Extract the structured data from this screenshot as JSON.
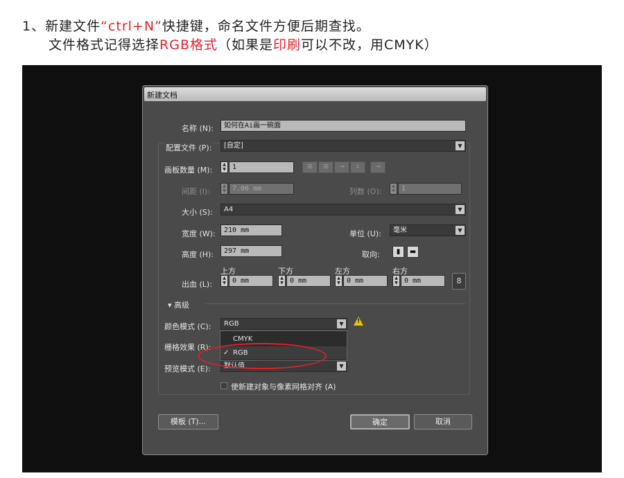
{
  "caption": {
    "line1_prefix": "1、新建文件",
    "line1_highlight": "“ctrl+N”",
    "line1_suffix": "快捷键，命名文件方便后期查找。",
    "line2_prefix": "文件格式记得选择",
    "line2_highlight1": "RGB格式",
    "line2_mid": "（如果是",
    "line2_highlight2": "印刷",
    "line2_suffix": "可以不改，用CMYK）"
  },
  "dialog": {
    "title": "新建文档",
    "name_label": "名称 (N):",
    "name_value": "如何在Ai画一碗面",
    "profile_label": "配置文件 (P):",
    "profile_value": "[自定]",
    "artboards_label": "画板数量 (M):",
    "artboards_value": "1",
    "spacing_label": "间距 (I):",
    "spacing_value": "7.06 mm",
    "columns_label": "列数 (O):",
    "columns_value": "1",
    "size_label": "大小 (S):",
    "size_value": "A4",
    "width_label": "宽度 (W):",
    "width_value": "210 mm",
    "units_label": "单位 (U):",
    "units_value": "毫米",
    "height_label": "高度 (H):",
    "height_value": "297 mm",
    "orientation_label": "取向:",
    "bleed_label": "出血 (L):",
    "bleed_top_label": "上方",
    "bleed_bottom_label": "下方",
    "bleed_left_label": "左方",
    "bleed_right_label": "右方",
    "bleed_top": "0 mm",
    "bleed_bottom": "0 mm",
    "bleed_left": "0 mm",
    "bleed_right": "0 mm",
    "advanced_label": "▾ 高级",
    "color_mode_label": "颜色模式 (C):",
    "color_mode_value": "RGB",
    "color_options": [
      "CMYK",
      "RGB"
    ],
    "raster_label": "栅格效果 (R):",
    "preview_label": "预览模式 (E):",
    "preview_value": "默认值",
    "align_label": "使新建对象与像素网格对齐 (A)",
    "templates_button": "模板 (T)...",
    "ok_button": "确定",
    "cancel_button": "取消"
  },
  "colors": {
    "highlight": "#e0202a",
    "dialog_bg": "#4a4a4a",
    "warning": "#f2c200"
  }
}
